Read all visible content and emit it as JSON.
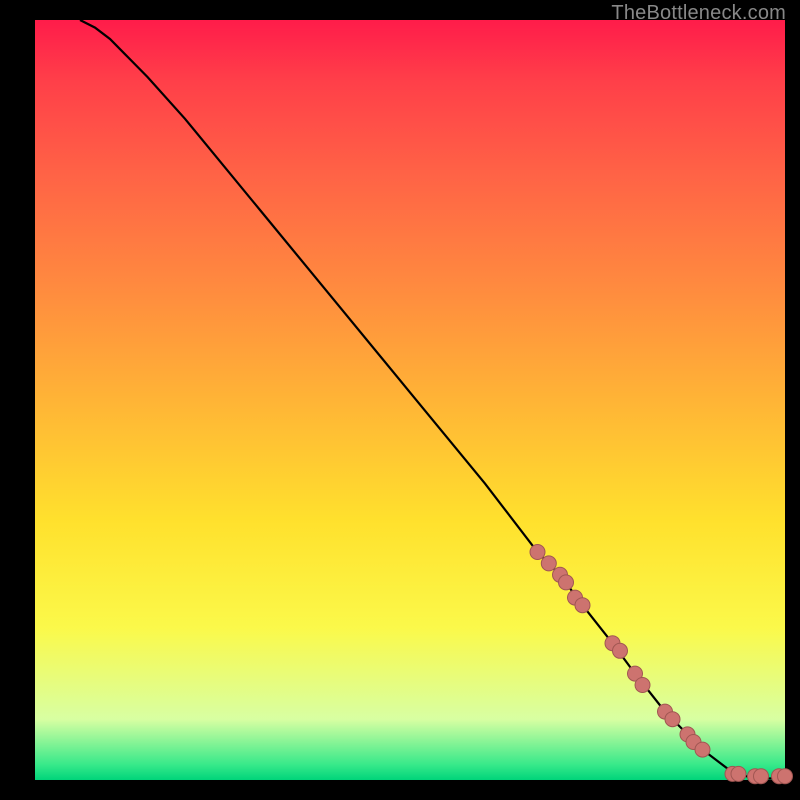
{
  "attribution": "TheBottleneck.com",
  "colors": {
    "dot_fill": "#cd736f",
    "dot_stroke": "#a05652",
    "curve": "#000000",
    "gradient": [
      "#ff1c4a",
      "#ff3f49",
      "#ff6246",
      "#ff8a3f",
      "#ffb436",
      "#ffe12d",
      "#fbf94a",
      "#d8ffa2",
      "#37e98a",
      "#00d47a"
    ]
  },
  "chart_data": {
    "type": "line",
    "title": "",
    "xlabel": "",
    "ylabel": "",
    "xlim": [
      0,
      100
    ],
    "ylim": [
      0,
      100
    ],
    "grid": false,
    "series": [
      {
        "name": "curve",
        "x": [
          6,
          8,
          10,
          12,
          15,
          20,
          30,
          40,
          50,
          60,
          67,
          70,
          73,
          77,
          80,
          84,
          87,
          89,
          93,
          96,
          100
        ],
        "y": [
          100,
          99,
          97.5,
          95.5,
          92.5,
          87,
          75,
          63,
          51,
          39,
          30,
          27,
          23,
          18,
          14,
          9,
          6,
          4,
          1,
          0.2,
          0.2
        ]
      }
    ],
    "scatter": [
      {
        "name": "dots-on-curve",
        "x": [
          67,
          68.5,
          70,
          70.8,
          72,
          73,
          77,
          78,
          80,
          81,
          84,
          85,
          87,
          87.8,
          89
        ],
        "y": [
          30,
          28.5,
          27,
          26,
          24,
          23,
          18,
          17,
          14,
          12.5,
          9,
          8,
          6,
          5,
          4
        ]
      },
      {
        "name": "dots-baseline",
        "x": [
          93,
          93.8,
          96,
          96.8,
          99.2,
          100
        ],
        "y": [
          0.8,
          0.8,
          0.5,
          0.5,
          0.5,
          0.5
        ]
      }
    ]
  }
}
